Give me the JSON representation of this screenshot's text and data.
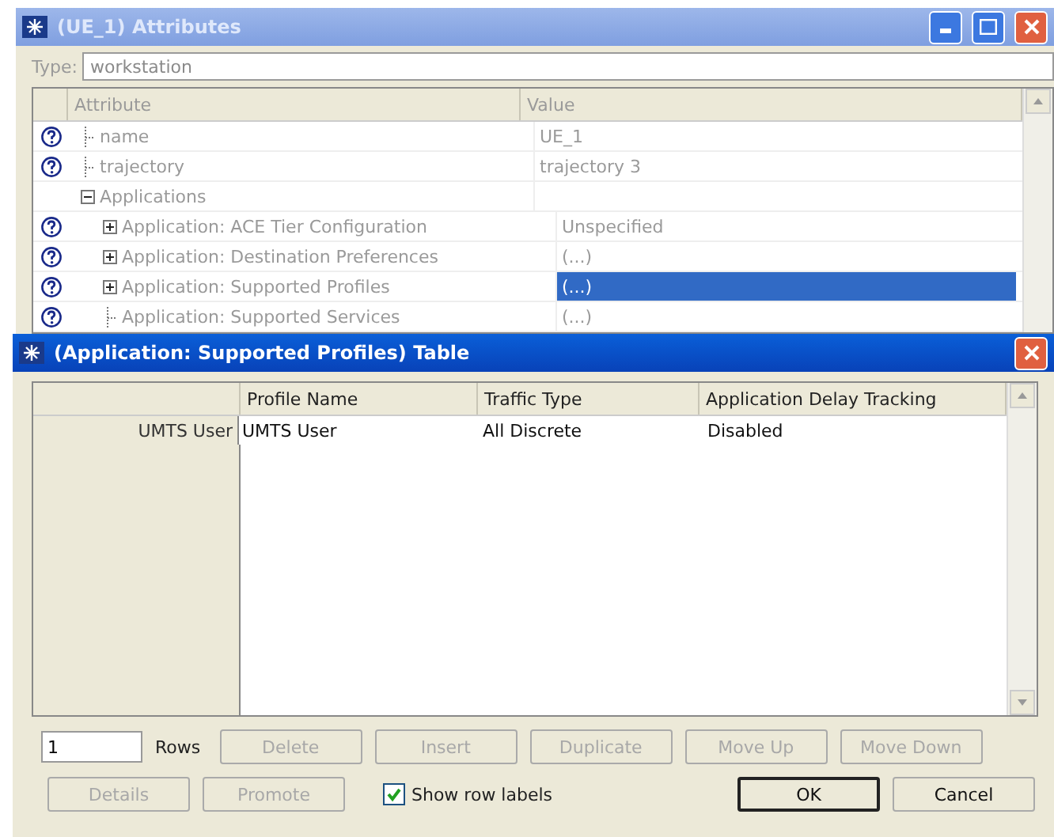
{
  "attributes_window": {
    "title": "(UE_1) Attributes",
    "active": false,
    "type_label": "Type:",
    "type_value": "workstation",
    "columns": [
      "Attribute",
      "Value"
    ],
    "rows": [
      {
        "kind": "leaf",
        "name": "name",
        "value": "UE_1",
        "help": true,
        "selected": false
      },
      {
        "kind": "leaf",
        "name": "trajectory",
        "value": "trajectory 3",
        "help": true,
        "selected": false
      },
      {
        "kind": "node",
        "name": "Applications",
        "help": false,
        "expanded": true,
        "selected": false,
        "children": [
          {
            "kind": "node",
            "name": "Application: ACE Tier Configuration",
            "value": "Unspecified",
            "help": true,
            "expanded": false,
            "selected": false
          },
          {
            "kind": "node",
            "name": "Application: Destination Preferences",
            "value": "(...)",
            "help": true,
            "expanded": false,
            "selected": false
          },
          {
            "kind": "node",
            "name": "Application: Supported Profiles",
            "value": "(...)",
            "help": true,
            "expanded": false,
            "selected": true
          },
          {
            "kind": "leaf",
            "name": "Application: Supported Services",
            "value": "(...)",
            "help": true,
            "selected": false
          }
        ]
      }
    ]
  },
  "table_window": {
    "title": "(Application: Supported Profiles) Table",
    "active": true,
    "columns": [
      "Profile Name",
      "Traffic Type",
      "Application Delay Tracking"
    ],
    "rows": [
      {
        "label": "UMTS User",
        "cells": [
          "UMTS User",
          "All Discrete",
          "Disabled"
        ]
      }
    ],
    "rows_count": "1",
    "rows_label": "Rows",
    "buttons_row_1": [
      {
        "label": "Delete",
        "disabled": true
      },
      {
        "label": "Insert",
        "disabled": true
      },
      {
        "label": "Duplicate",
        "disabled": true
      },
      {
        "label": "Move Up",
        "disabled": true
      },
      {
        "label": "Move Down",
        "disabled": true
      }
    ],
    "buttons_row_2": [
      {
        "label": "Details",
        "disabled": true
      },
      {
        "label": "Promote",
        "disabled": true
      }
    ],
    "show_row_labels": {
      "label": "Show row labels",
      "checked": true
    },
    "dialog_buttons": [
      {
        "label": "OK",
        "disabled": false,
        "default": true
      },
      {
        "label": "Cancel",
        "disabled": false,
        "default": false
      }
    ]
  }
}
